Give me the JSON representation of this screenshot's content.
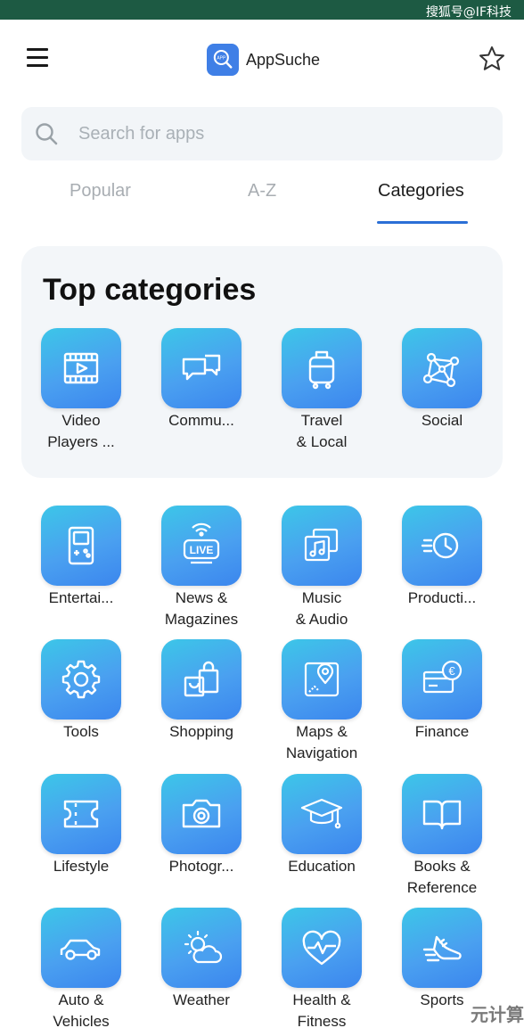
{
  "status_bar": {
    "right_text": "搜狐号@IF科技"
  },
  "header": {
    "app_name": "AppSuche",
    "logo_text": "APP"
  },
  "search": {
    "placeholder": "Search for apps"
  },
  "tabs": [
    {
      "label": "Popular",
      "active": false
    },
    {
      "label": "A-Z",
      "active": false
    },
    {
      "label": "Categories",
      "active": true
    }
  ],
  "top_categories": {
    "title": "Top categories",
    "items": [
      {
        "label": "Video\nPlayers ...",
        "icon": "video-player-icon"
      },
      {
        "label": "Commu...",
        "icon": "chat-bubbles-icon"
      },
      {
        "label": "Travel\n& Local",
        "icon": "luggage-icon"
      },
      {
        "label": "Social",
        "icon": "network-icon"
      }
    ]
  },
  "categories": [
    {
      "label": "Entertai...",
      "icon": "game-console-icon"
    },
    {
      "label": "News &\nMagazines",
      "icon": "live-broadcast-icon"
    },
    {
      "label": "Music\n& Audio",
      "icon": "music-notes-icon"
    },
    {
      "label": "Producti...",
      "icon": "fast-clock-icon"
    },
    {
      "label": "Tools",
      "icon": "gear-icon"
    },
    {
      "label": "Shopping",
      "icon": "shopping-bag-icon"
    },
    {
      "label": "Maps &\nNavigation",
      "icon": "map-pin-icon"
    },
    {
      "label": "Finance",
      "icon": "euro-card-icon"
    },
    {
      "label": "Lifestyle",
      "icon": "ticket-icon"
    },
    {
      "label": "Photogr...",
      "icon": "camera-icon"
    },
    {
      "label": "Education",
      "icon": "graduation-cap-icon"
    },
    {
      "label": "Books &\nReference",
      "icon": "open-book-icon"
    },
    {
      "label": "Auto &\nVehicles",
      "icon": "car-icon"
    },
    {
      "label": "Weather",
      "icon": "sun-cloud-icon"
    },
    {
      "label": "Health &\nFitness",
      "icon": "heartbeat-icon"
    },
    {
      "label": "Sports",
      "icon": "running-shoe-icon"
    }
  ],
  "corner_mark": "元计算",
  "colors": {
    "accent": "#2b6fd6",
    "tile_top": "#3cc6e8",
    "tile_bottom": "#3b86ee",
    "status_bar": "#1d5a43"
  }
}
